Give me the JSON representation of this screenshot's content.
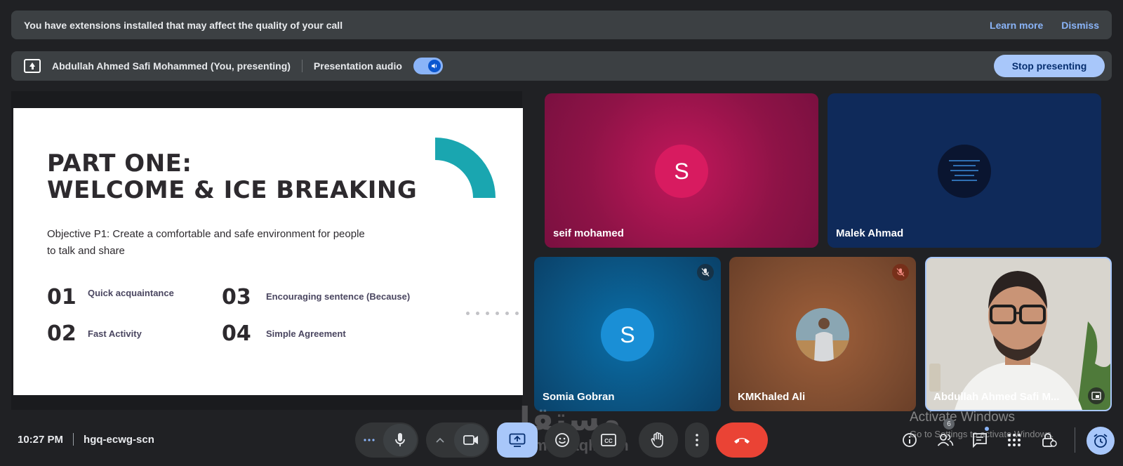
{
  "extension_banner": {
    "message": "You have extensions installed that may affect the quality of your call",
    "learn_more": "Learn more",
    "dismiss": "Dismiss"
  },
  "presenting_bar": {
    "presenter": "Abdullah Ahmed Safi Mohammed (You, presenting)",
    "audio_label": "Presentation audio",
    "audio_on": true,
    "stop_label": "Stop presenting"
  },
  "slide": {
    "title_line1": "PART ONE:",
    "title_line2": "WELCOME & ICE BREAKING",
    "objective": "Objective P1: Create a comfortable and safe environment for people to talk and share",
    "items": [
      {
        "num": "01",
        "label": "Quick acquaintance"
      },
      {
        "num": "02",
        "label": "Fast Activity"
      },
      {
        "num": "03",
        "label": "Encouraging sentence (Because)"
      },
      {
        "num": "04",
        "label": "Simple Agreement"
      }
    ],
    "accent": "#1aa6b0"
  },
  "participants": [
    {
      "name": "seif mohamed",
      "initial": "S",
      "avatar_color": "#d81b60",
      "muted": false
    },
    {
      "name": "Malek Ahmad",
      "initial": "",
      "avatar_color": "#0a1530",
      "muted": false
    },
    {
      "name": "Somia Gobran",
      "initial": "S",
      "avatar_color": "#1a8fd6",
      "muted": true
    },
    {
      "name": "KMKhaled Ali",
      "initial": "",
      "avatar_color": "#6e8fa0",
      "muted": true
    },
    {
      "name": "Abdullah Ahmed Safi M...",
      "initial": "",
      "avatar_color": "",
      "muted": false
    }
  ],
  "meeting": {
    "time": "10:27 PM",
    "code": "hgq-ecwg-scn",
    "people_count": "6"
  },
  "watermark": {
    "title": "Activate Windows",
    "sub": "Go to Settings to activate Windows.",
    "logo_text": "مستقل",
    "logo_sub": "mostaql.com"
  },
  "colors": {
    "background": "#202124",
    "banner": "#3c4043",
    "link": "#8ab4f8",
    "end_call": "#ea4335",
    "present_active": "#a8c7fa"
  }
}
